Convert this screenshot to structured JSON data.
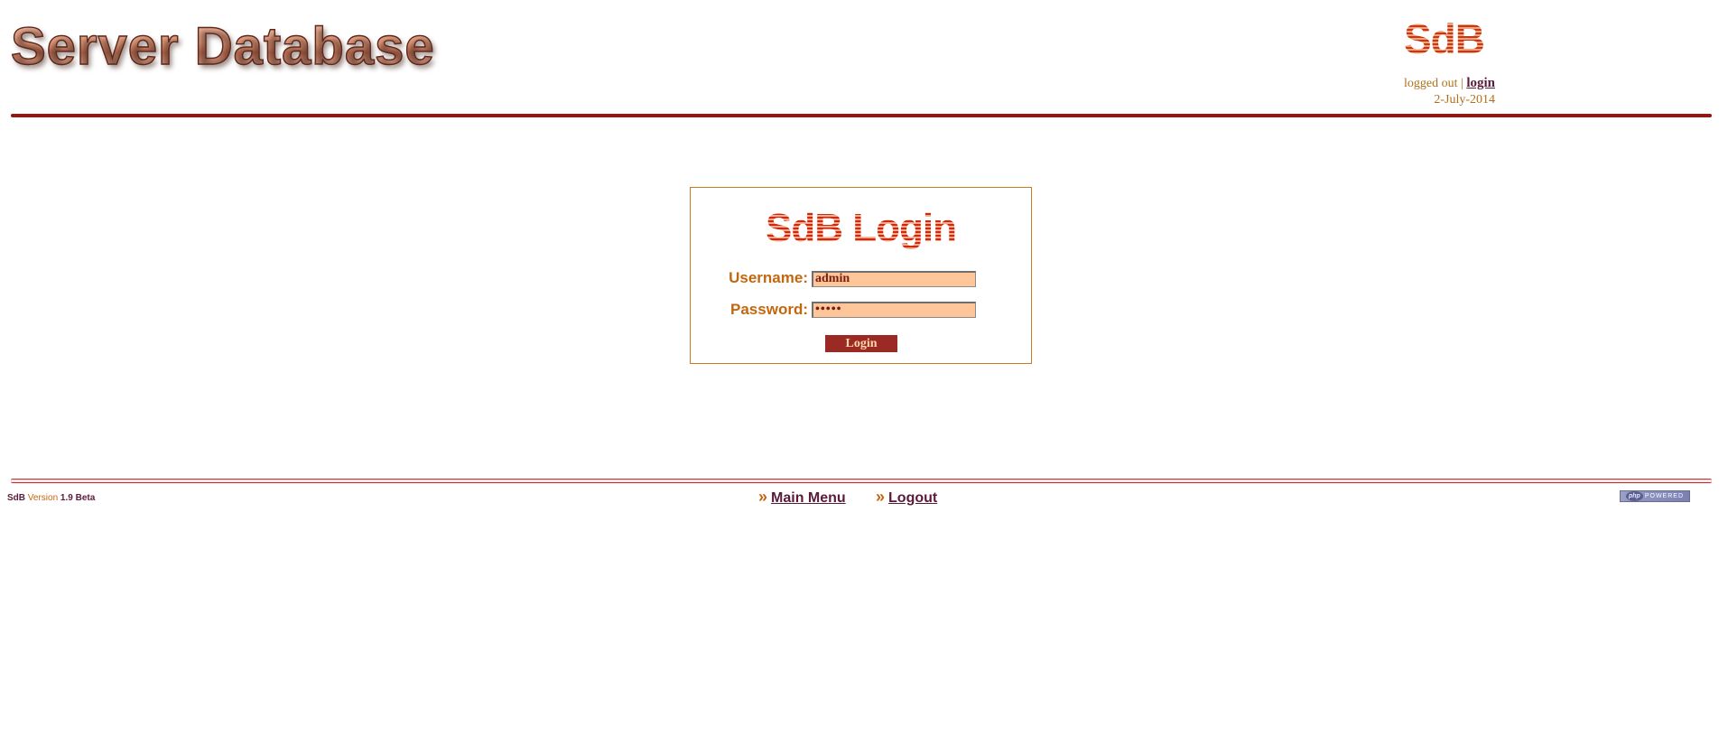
{
  "header": {
    "title": "Server Database",
    "brand_mini": "SdB",
    "status_text": "logged out | ",
    "login_link": "login",
    "date": "2-July-2014"
  },
  "login": {
    "heading": "SdB Login",
    "username_label": "Username:",
    "username_value": "admin",
    "password_label": "Password:",
    "password_mask": "•••••",
    "submit_label": "Login"
  },
  "footer": {
    "version_prefix": "SdB ",
    "version_word": "Version",
    "version_number": " 1.9 Beta",
    "nav": {
      "main_menu": "Main Menu",
      "logout": "Logout",
      "arrow": "»"
    },
    "powered_badge": {
      "logo": "php",
      "text": "POWERED"
    }
  },
  "colors": {
    "accent": "#8e1a12",
    "label": "#c3670f",
    "link": "#5a1b3a",
    "input_bg": "#ffc799",
    "button_bg": "#9c2a24"
  }
}
